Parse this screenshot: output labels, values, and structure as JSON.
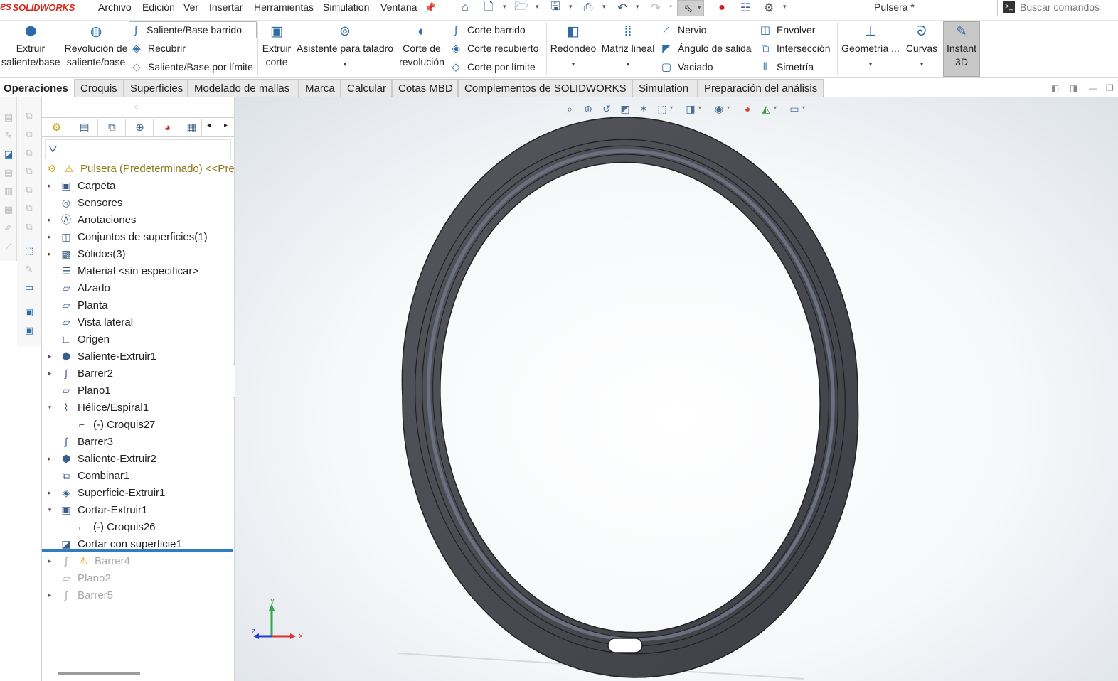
{
  "app": {
    "brand": "SOLIDWORKS",
    "document_title": "Pulsera *"
  },
  "menu": [
    "Archivo",
    "Edición",
    "Ver",
    "Insertar",
    "Herramientas",
    "Simulation",
    "Ventana"
  ],
  "search": {
    "placeholder": "Buscar comandos"
  },
  "quick_access_icons": [
    "home-icon",
    "new-document-icon",
    "open-icon",
    "save-icon",
    "print-icon",
    "undo-icon",
    "redo-icon",
    "select-icon",
    "rebuild-icon",
    "file-properties-icon",
    "options-icon"
  ],
  "ribbon": {
    "extruir": "Extruir\nsaliente/base",
    "extruir_l1": "Extruir",
    "extruir_l2": "saliente/base",
    "revolucion_l1": "Revolución de",
    "revolucion_l2": "saliente/base",
    "saliente_barrido": "Saliente/Base barrido",
    "recubrir": "Recubrir",
    "saliente_limite": "Saliente/Base por límite",
    "extruir_corte_l1": "Extruir",
    "extruir_corte_l2": "corte",
    "asistente_taladro": "Asistente para taladro",
    "corte_revolucion_l1": "Corte de",
    "corte_revolucion_l2": "revolución",
    "corte_barrido": "Corte barrido",
    "corte_recubierto": "Corte recubierto",
    "corte_limite": "Corte por límite",
    "redondeo": "Redondeo",
    "matriz_lineal": "Matriz lineal",
    "nervio": "Nervio",
    "angulo_salida": "Ángulo de salida",
    "vaciado": "Vaciado",
    "envolver": "Envolver",
    "interseccion": "Intersección",
    "simetria": "Simetría",
    "geometria": "Geometría ...",
    "curvas": "Curvas",
    "instant3d_l1": "Instant",
    "instant3d_l2": "3D"
  },
  "tabs": [
    "Operaciones",
    "Croquis",
    "Superficies",
    "Modelado de mallas",
    "Marca",
    "Calcular",
    "Cotas MBD",
    "Complementos de SOLIDWORKS",
    "Simulation",
    "Preparación del análisis"
  ],
  "active_tab": "Operaciones",
  "feature_tree": [
    {
      "label": "Pulsera (Predeterminado) <<Predeterminado>",
      "icon": "part-icon",
      "expander": "",
      "state": "root",
      "warning": true
    },
    {
      "label": "Carpeta",
      "icon": "folder-icon",
      "expander": "▸",
      "state": "normal"
    },
    {
      "label": "Sensores",
      "icon": "sensor-icon",
      "expander": "",
      "state": "normal"
    },
    {
      "label": "Anotaciones",
      "icon": "annotations-icon",
      "expander": "▸",
      "state": "normal"
    },
    {
      "label": "Conjuntos de superficies(1)",
      "icon": "surface-bodies-icon",
      "expander": "▸",
      "state": "normal"
    },
    {
      "label": "Sólidos(3)",
      "icon": "solid-bodies-icon",
      "expander": "▸",
      "state": "normal"
    },
    {
      "label": "Material <sin especificar>",
      "icon": "material-icon",
      "expander": "",
      "state": "normal"
    },
    {
      "label": "Alzado",
      "icon": "plane-icon",
      "expander": "",
      "state": "normal"
    },
    {
      "label": "Planta",
      "icon": "plane-icon",
      "expander": "",
      "state": "normal"
    },
    {
      "label": "Vista lateral",
      "icon": "plane-icon",
      "expander": "",
      "state": "normal"
    },
    {
      "label": "Origen",
      "icon": "origin-icon",
      "expander": "",
      "state": "normal"
    },
    {
      "label": "Saliente-Extruir1",
      "icon": "extrude-icon",
      "expander": "▸",
      "state": "normal"
    },
    {
      "label": "Barrer2",
      "icon": "sweep-icon",
      "expander": "▸",
      "state": "normal"
    },
    {
      "label": "Plano1",
      "icon": "plane-icon",
      "expander": "",
      "state": "normal"
    },
    {
      "label": "Hélice/Espiral1",
      "icon": "helix-icon",
      "expander": "▾",
      "state": "normal"
    },
    {
      "label": "(-) Croquis27",
      "icon": "sketch-icon",
      "expander": "",
      "state": "child"
    },
    {
      "label": "Barrer3",
      "icon": "sweep-icon",
      "expander": "",
      "state": "normal"
    },
    {
      "label": "Saliente-Extruir2",
      "icon": "extrude-icon",
      "expander": "▸",
      "state": "normal"
    },
    {
      "label": "Combinar1",
      "icon": "combine-icon",
      "expander": "",
      "state": "normal"
    },
    {
      "label": "Superficie-Extruir1",
      "icon": "surface-extrude-icon",
      "expander": "▸",
      "state": "normal"
    },
    {
      "label": "Cortar-Extruir1",
      "icon": "cut-extrude-icon",
      "expander": "▾",
      "state": "normal"
    },
    {
      "label": "(-) Croquis26",
      "icon": "sketch-icon",
      "expander": "",
      "state": "child"
    },
    {
      "label": "Cortar con superficie1",
      "icon": "surface-cut-icon",
      "expander": "",
      "state": "normal"
    },
    {
      "label": "Barrer4",
      "icon": "sweep-icon",
      "expander": "▸",
      "state": "suppressed",
      "warning": true
    },
    {
      "label": "Plano2",
      "icon": "plane-icon",
      "expander": "",
      "state": "suppressed"
    },
    {
      "label": "Barrer5",
      "icon": "sweep-icon",
      "expander": "▸",
      "state": "suppressed"
    }
  ],
  "triad": {
    "x": "X",
    "y": "Y",
    "z": "Z"
  },
  "colors": {
    "accent": "#2e7fc1",
    "brand": "#d52b1e",
    "model": "#4a4c52"
  }
}
